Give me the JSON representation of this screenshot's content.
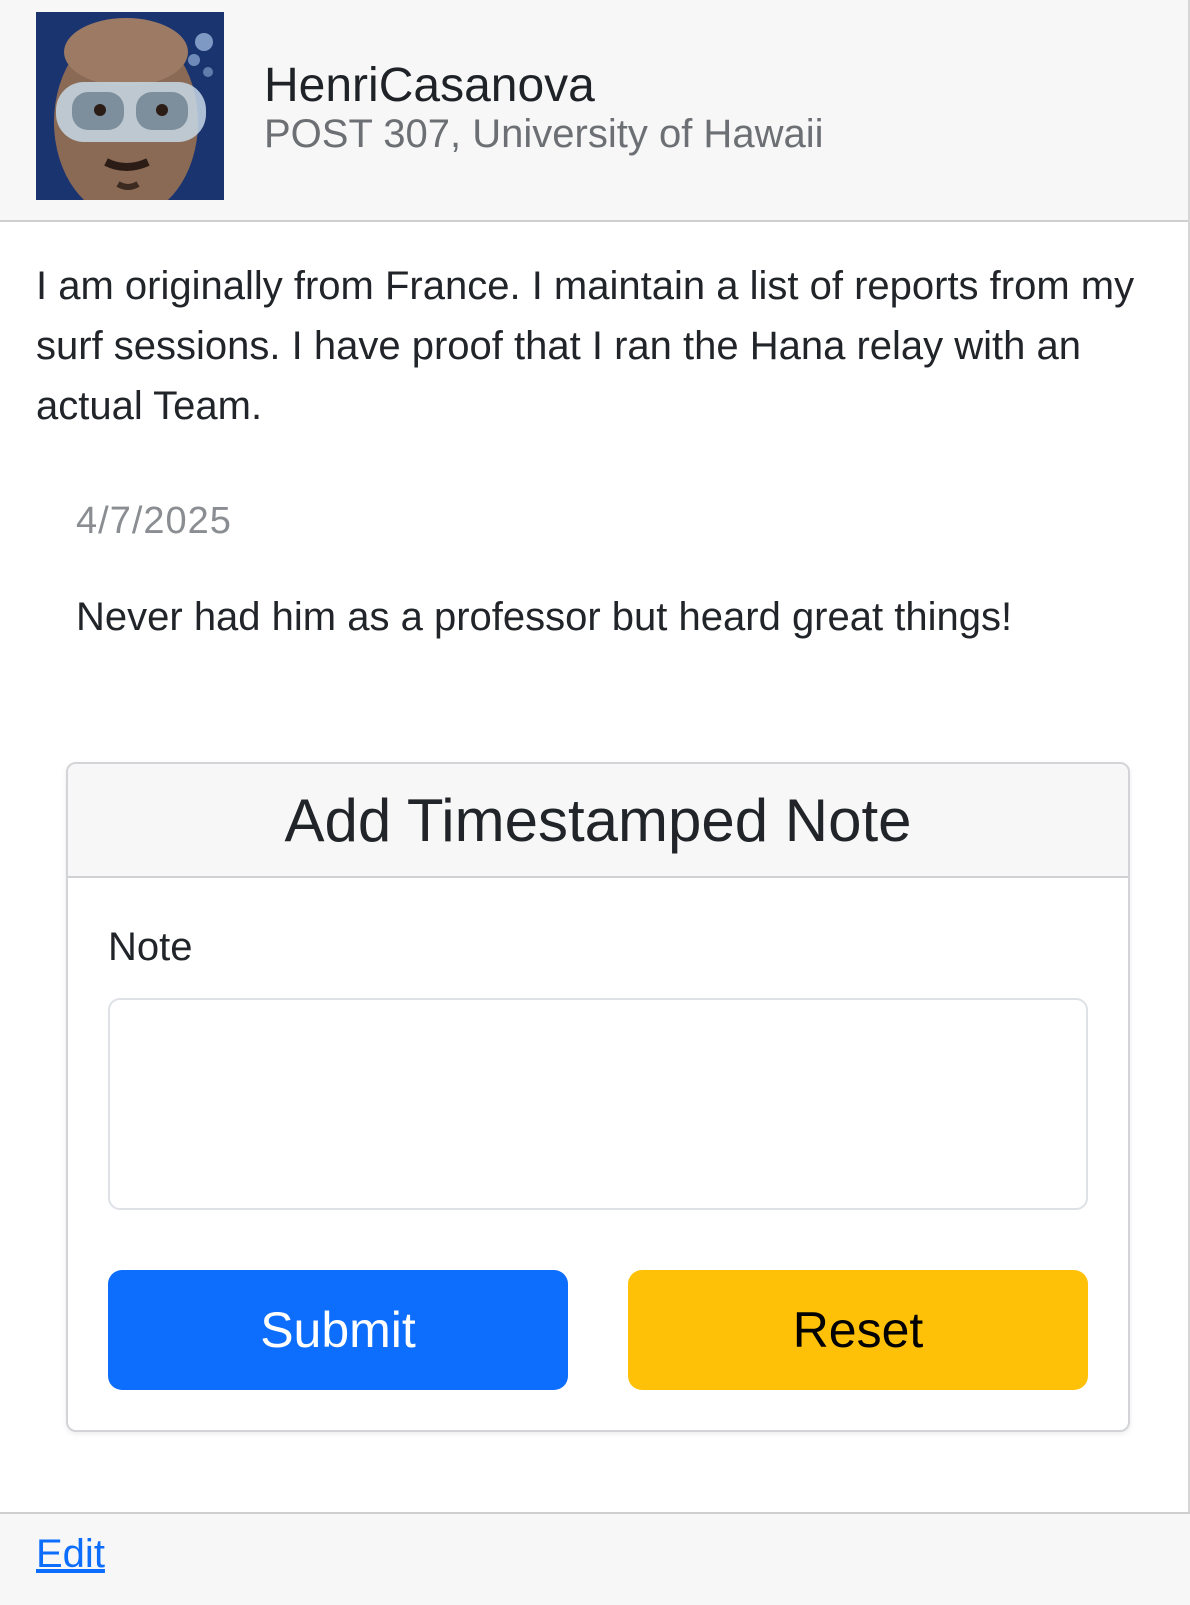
{
  "profile": {
    "name": "HenriCasanova",
    "subtitle": "POST 307, University of Hawaii",
    "bio": "I am originally from France. I maintain a list of reports from my surf sessions. I have proof that I ran the Hana relay with an actual Team.",
    "avatar_icon": "profile-photo-diver"
  },
  "notes": [
    {
      "date": "4/7/2025",
      "text": "Never had him as a professor but heard great things!"
    }
  ],
  "form": {
    "title": "Add Timestamped Note",
    "note_label": "Note",
    "note_value": "",
    "submit_label": "Submit",
    "reset_label": "Reset"
  },
  "footer": {
    "edit_label": "Edit"
  },
  "colors": {
    "primary": "#0d6efd",
    "warning": "#ffc107",
    "header_bg": "#f7f7f7"
  }
}
